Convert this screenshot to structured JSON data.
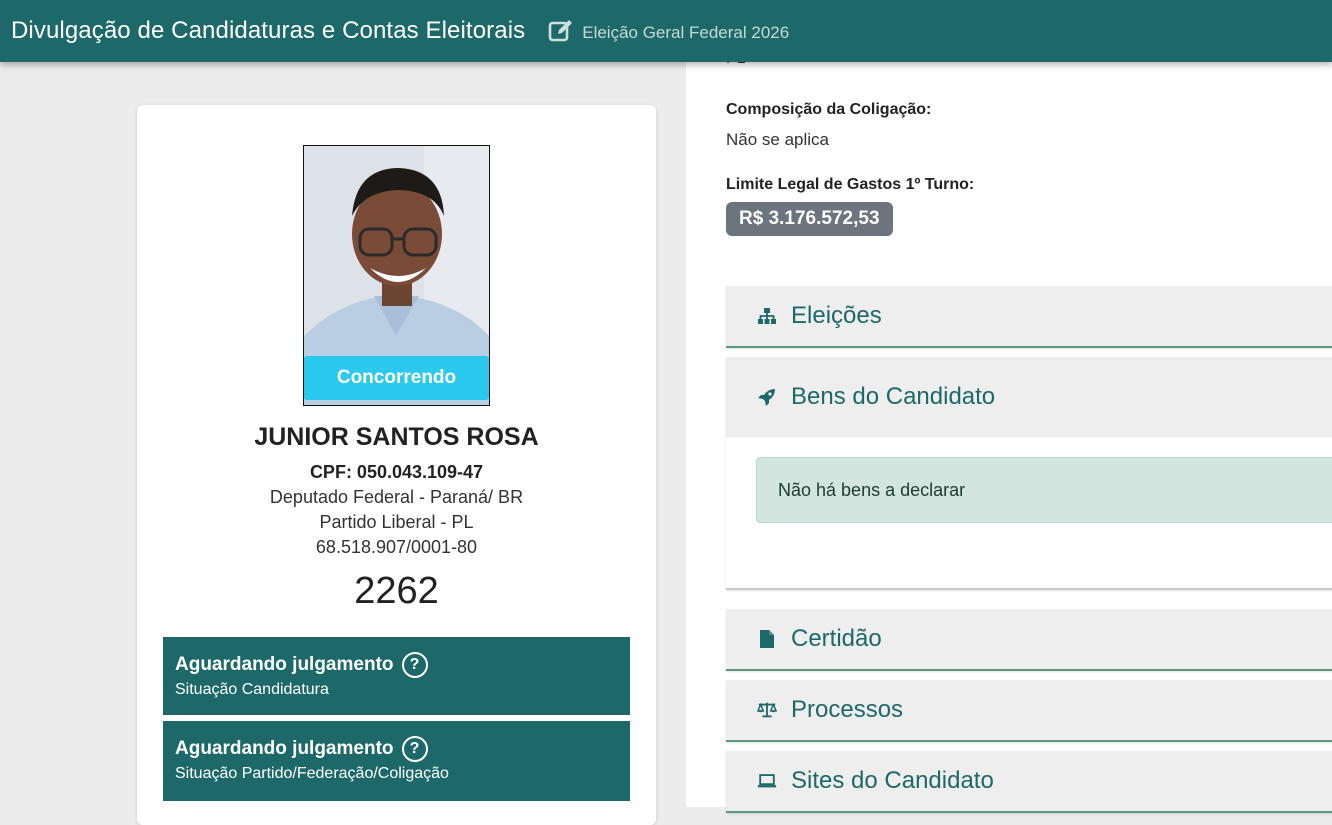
{
  "header": {
    "app_title": "Divulgação de Candidaturas e Contas Eleitorais",
    "election_name": "Eleição Geral Federal 2026"
  },
  "candidate": {
    "status_ribbon": "Concorrendo",
    "name": "JUNIOR SANTOS ROSA",
    "cpf": "CPF: 050.043.109-47",
    "office": "Deputado Federal - Paraná/ BR",
    "party": "Partido Liberal - PL",
    "cnpj": "68.518.907/0001-80",
    "number": "2262"
  },
  "situations": [
    {
      "status": "Aguardando julgamento",
      "label": "Situação Candidatura"
    },
    {
      "status": "Aguardando julgamento",
      "label": "Situação Partido/Federação/Coligação"
    }
  ],
  "details": {
    "partial_top_value": "PL",
    "coalition_label": "Composição da Coligação:",
    "coalition_value": "Não se aplica",
    "spending_label": "Limite Legal de Gastos 1º Turno:",
    "spending_value": "R$ 3.176.572,53"
  },
  "accordions": {
    "eleicoes": {
      "title": "Eleições",
      "icon": "sitemap-icon"
    },
    "bens": {
      "title": "Bens do Candidato",
      "icon": "rocket-icon",
      "message": "Não há bens a declarar"
    },
    "certidao": {
      "title": "Certidão",
      "icon": "file-icon"
    },
    "processos": {
      "title": "Processos",
      "icon": "balance-scale-icon"
    },
    "sites": {
      "title": "Sites do Candidato",
      "icon": "laptop-icon"
    }
  },
  "colors": {
    "primary": "#1d6869",
    "ribbon": "#2bc9ee",
    "badge": "#6c757d",
    "alert_bg": "#d2e6df"
  }
}
